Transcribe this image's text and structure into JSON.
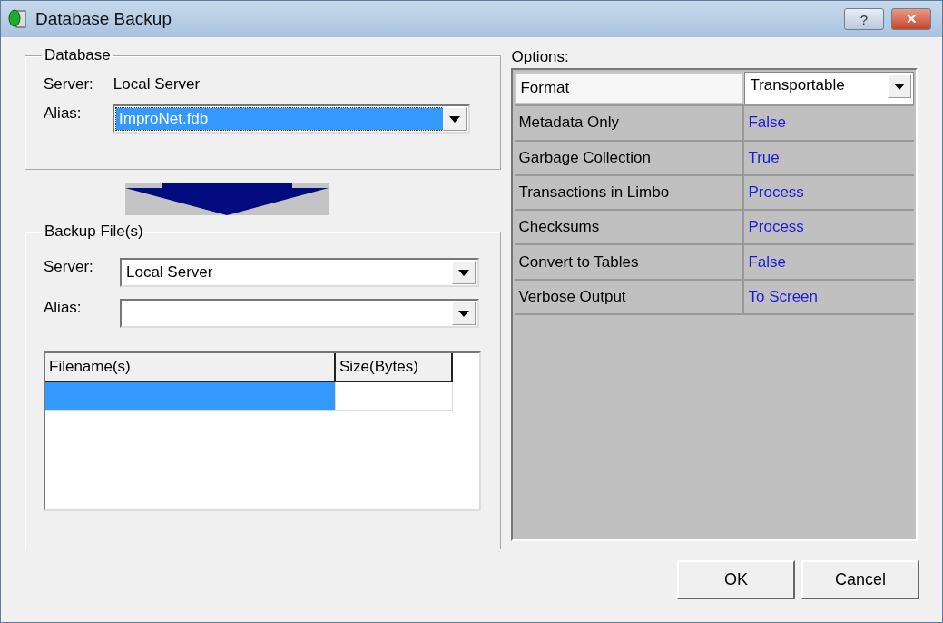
{
  "window": {
    "title": "Database Backup",
    "buttons": [
      "?",
      "✕"
    ]
  },
  "database": {
    "legend": "Database",
    "server_label": "Server:",
    "server_value": "Local Server",
    "alias_label": "Alias:",
    "alias_value": "ImproNet.fdb",
    "alias_selected": true
  },
  "backup_files": {
    "legend": "Backup File(s)",
    "server_label": "Server:",
    "server_value": "Local Server",
    "alias_label": "Alias:",
    "table": {
      "columns": [
        "Filename(s)",
        "Size(Bytes)"
      ],
      "rows": [
        [
          {
            "text": "",
            "selected": true
          },
          {
            "text": "",
            "selected": false
          }
        ]
      ]
    }
  },
  "options": {
    "label": "Options:",
    "rows": [
      {
        "name": "Format",
        "value": "Transportable",
        "kind": "dropdown",
        "selected": true
      },
      {
        "name": "Metadata Only",
        "value": "False",
        "kind": "text",
        "selected": false
      },
      {
        "name": "Garbage Collection",
        "value": "True",
        "kind": "text",
        "selected": false
      },
      {
        "name": "Transactions in Limbo",
        "value": "Process",
        "kind": "text",
        "selected": false
      },
      {
        "name": "Checksums",
        "value": "Process",
        "kind": "text",
        "selected": false
      },
      {
        "name": "Convert to Tables",
        "value": "False",
        "kind": "text",
        "selected": false
      },
      {
        "name": "Verbose Output",
        "value": "To Screen",
        "kind": "text",
        "selected": false
      }
    ]
  },
  "buttons": [
    "OK",
    "Cancel"
  ]
}
